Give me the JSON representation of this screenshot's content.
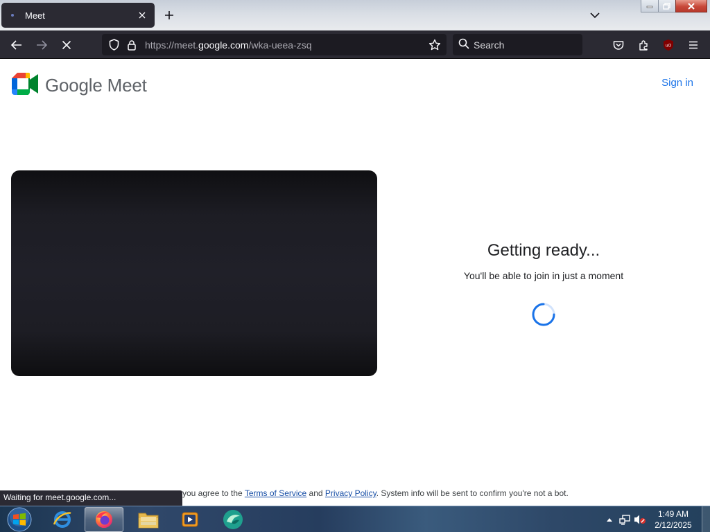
{
  "browser": {
    "tab": {
      "title": "Meet"
    },
    "url": {
      "prefix": "https://meet.",
      "domain": "google.com",
      "path": "/wka-ueea-zsq"
    },
    "search": {
      "placeholder": "Search"
    },
    "status": "Waiting for meet.google.com..."
  },
  "page": {
    "brand": "Google Meet",
    "sign_in": "Sign in",
    "ready_title": "Getting ready...",
    "ready_subtitle": "You'll be able to join in just a moment",
    "footer": {
      "prefix": "you agree to the ",
      "terms": "Terms of Service",
      "and": " and ",
      "privacy": "Privacy Policy",
      "suffix": ". System info will be sent to confirm you're not a bot."
    }
  },
  "taskbar": {
    "apps": [
      "start-orb",
      "internet-explorer",
      "firefox",
      "file-explorer",
      "media-player",
      "app-icon"
    ],
    "clock": {
      "time": "1:49 AM",
      "date": "2/12/2025"
    }
  },
  "colors": {
    "accent": "#1a73e8",
    "browser_chrome": "#2b2a33",
    "meet_green": "#00832d",
    "meet_blue": "#0066da"
  }
}
